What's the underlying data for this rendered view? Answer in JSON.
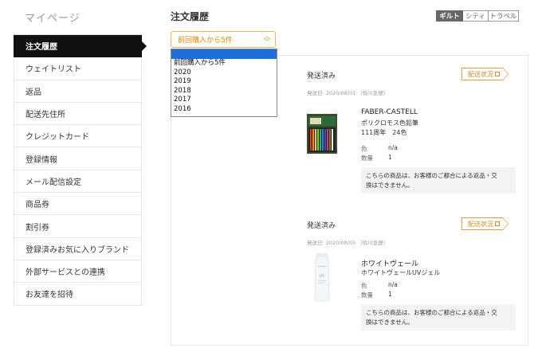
{
  "sidebar": {
    "title": "マイページ",
    "items": [
      {
        "label": "注文履歴"
      },
      {
        "label": "ウェイトリスト"
      },
      {
        "label": "返品"
      },
      {
        "label": "配送先住所"
      },
      {
        "label": "クレジットカード"
      },
      {
        "label": "登録情報"
      },
      {
        "label": "メール配信設定"
      },
      {
        "label": "商品券"
      },
      {
        "label": "割引券"
      },
      {
        "label": "登録済みお気に入りブランド"
      },
      {
        "label": "外部サービスとの連携"
      },
      {
        "label": "お友達を招待"
      }
    ]
  },
  "header": {
    "title": "注文履歴",
    "segments": [
      "ギルト",
      "シティ",
      "トラベル"
    ]
  },
  "filter": {
    "selected": "前回購入から5件",
    "options": [
      "",
      "前回購入から5件",
      "2020",
      "2019",
      "2018",
      "2017",
      "2016"
    ]
  },
  "orders": [
    {
      "status": "発送済み",
      "date": "発送日: 2020/08/01 （佐川急便）",
      "track_label": "配送状況",
      "brand": "FABER-CASTELL",
      "name": "ポリクロモス色鉛筆",
      "variant": "111周年　24色",
      "color_label": "色",
      "color_value": "n/a",
      "qty_label": "数量",
      "qty_value": "1",
      "note_line1": "こちらの商品は、お客様のご都合による返品・交",
      "note_line2": "換はできません。"
    },
    {
      "status": "発送済み",
      "date": "発送日: 2020/08/05 （佐川急便）",
      "track_label": "配送状況",
      "brand": "ホワイトヴェール",
      "name": "ホワイトヴェールUVジェル",
      "variant": "",
      "color_label": "色",
      "color_value": "n/a",
      "qty_label": "数量",
      "qty_value": "1",
      "note_line1": "こちらの商品は、お客様のご都合による返品・交",
      "note_line2": "換はできません。"
    }
  ],
  "colors": {
    "accent": "#e08a00",
    "active_nav": "#111111",
    "select_highlight": "#1e6fd9"
  }
}
